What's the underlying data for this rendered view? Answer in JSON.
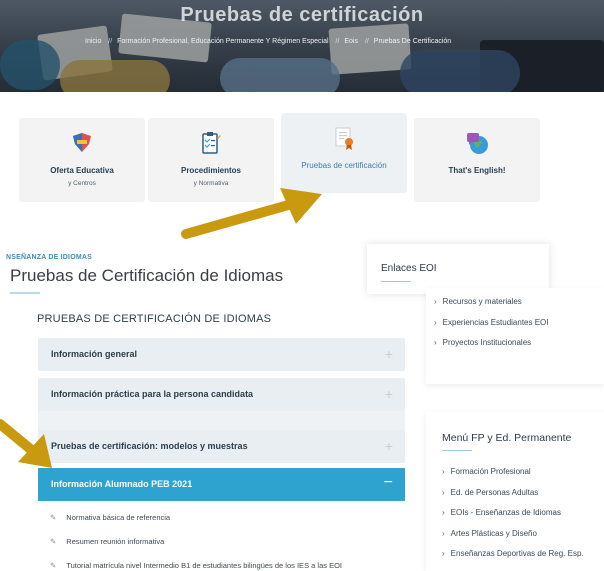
{
  "hero": {
    "title": "Pruebas de certificación",
    "breadcrumb": [
      "Inicio",
      "Formación Profesional, Educación Permanente Y Régimen Especial",
      "Eois",
      "Pruebas De Certificación"
    ],
    "separator": "//"
  },
  "cards": [
    {
      "title": "Oferta Educativa",
      "subtitle": "y Centros",
      "icon": "flag-map-icon"
    },
    {
      "title": "Procedimientos",
      "subtitle": "y Normativa",
      "icon": "clipboard-checklist-icon"
    },
    {
      "title": "Pruebas de certificación",
      "subtitle": "",
      "icon": "certificate-icon"
    },
    {
      "title": "That's English!",
      "subtitle": "",
      "icon": "globe-chat-icon"
    }
  ],
  "section": {
    "kicker": "NSEÑANZA DE IDIOMAS",
    "title": "Pruebas de Certificación de Idiomas"
  },
  "enlaces": {
    "heading": "Enlaces EOI",
    "items": [
      "Recursos y materiales",
      "Experiencias Estudiantes EOI",
      "Proyectos Institucionales"
    ]
  },
  "menu_fp": {
    "heading": "Menú FP y Ed. Permanente",
    "items": [
      "Formación Profesional",
      "Ed. de Personas Adultas",
      "EOIs - Enseñanzas de Idiomas",
      "Artes Plásticas y Diseño",
      "Enseñanzas Deportivas de Reg. Esp."
    ]
  },
  "accordion": {
    "heading": "PRUEBAS DE CERTIFICACIÓN DE IDIOMAS",
    "items": [
      {
        "label": "Información general",
        "toggle": "+"
      },
      {
        "label": "Información práctica para la persona candidata",
        "toggle": "+"
      },
      {
        "label": "Pruebas de certificación: modelos y muestras",
        "toggle": "+"
      },
      {
        "label": "Información Alumnado PEB 2021",
        "toggle": "−"
      }
    ],
    "open_items": [
      "Normativa básica de referencia",
      "Resumen reunión informativa",
      "Tutorial matrícula nivel Intermedio B1 de estudiantes bilingües de los IES a las EOI"
    ]
  },
  "glyphs": {
    "chevron": "›",
    "attachment": "✎"
  },
  "colors": {
    "accent": "#2ea3cf",
    "arrow": "#c9990f",
    "accordion_bg": "#e8eef2"
  }
}
